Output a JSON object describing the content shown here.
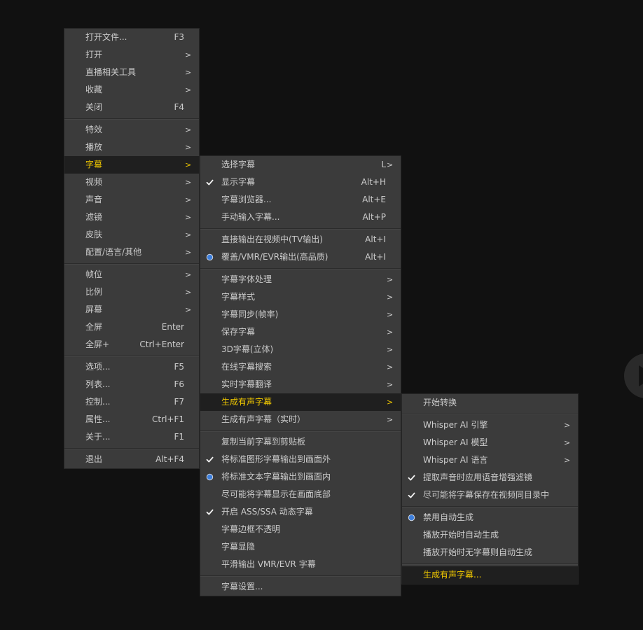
{
  "colors": {
    "page_background": "#111111",
    "menu_background": "#3b3b3b",
    "menu_text": "#cccccc",
    "highlight_background": "#1f1f1f",
    "highlight_text": "#f0c800",
    "radio_fill": "#3d7fdc"
  },
  "menus": {
    "main": {
      "sections": [
        [
          {
            "label": "打开文件...",
            "shortcut": "F3"
          },
          {
            "label": "打开",
            "arrow": ">"
          },
          {
            "label": "直播相关工具",
            "arrow": ">"
          },
          {
            "label": "收藏",
            "arrow": ">"
          },
          {
            "label": "关闭",
            "shortcut": "F4"
          }
        ],
        [
          {
            "label": "特效",
            "arrow": ">"
          },
          {
            "label": "播放",
            "arrow": ">"
          },
          {
            "label": "字幕",
            "arrow": ">",
            "highlighted": true
          },
          {
            "label": "视频",
            "arrow": ">"
          },
          {
            "label": "声音",
            "arrow": ">"
          },
          {
            "label": "滤镜",
            "arrow": ">"
          },
          {
            "label": "皮肤",
            "arrow": ">"
          },
          {
            "label": "配置/语言/其他",
            "arrow": ">"
          }
        ],
        [
          {
            "label": "帧位",
            "arrow": ">"
          },
          {
            "label": "比例",
            "arrow": ">"
          },
          {
            "label": "屏幕",
            "arrow": ">"
          },
          {
            "label": "全屏",
            "shortcut": "Enter"
          },
          {
            "label": "全屏+",
            "shortcut": "Ctrl+Enter"
          }
        ],
        [
          {
            "label": "选项...",
            "shortcut": "F5"
          },
          {
            "label": "列表...",
            "shortcut": "F6"
          },
          {
            "label": "控制...",
            "shortcut": "F7"
          },
          {
            "label": "属性...",
            "shortcut": "Ctrl+F1"
          },
          {
            "label": "关于...",
            "shortcut": "F1"
          }
        ],
        [
          {
            "label": "退出",
            "shortcut": "Alt+F4"
          }
        ]
      ]
    },
    "subtitle": {
      "sections": [
        [
          {
            "label": "选择字幕",
            "shortcut": "L",
            "arrow": ">"
          },
          {
            "label": "显示字幕",
            "shortcut": "Alt+H",
            "indicator": "check-icon"
          },
          {
            "label": "字幕浏览器...",
            "shortcut": "Alt+E"
          },
          {
            "label": "手动输入字幕...",
            "shortcut": "Alt+P"
          }
        ],
        [
          {
            "label": "直接输出在视频中(TV输出)",
            "shortcut": "Alt+I"
          },
          {
            "label": "覆盖/VMR/EVR输出(高品质)",
            "shortcut": "Alt+I",
            "indicator": "radio-dot-icon"
          }
        ],
        [
          {
            "label": "字幕字体处理",
            "arrow": ">"
          },
          {
            "label": "字幕样式",
            "arrow": ">"
          },
          {
            "label": "字幕同步(帧率)",
            "arrow": ">"
          },
          {
            "label": "保存字幕",
            "arrow": ">"
          },
          {
            "label": "3D字幕(立体)",
            "arrow": ">"
          },
          {
            "label": "在线字幕搜索",
            "arrow": ">"
          },
          {
            "label": "实时字幕翻译",
            "arrow": ">"
          },
          {
            "label": "生成有声字幕",
            "arrow": ">",
            "highlighted": true
          },
          {
            "label": "生成有声字幕（实时）",
            "arrow": ">"
          }
        ],
        [
          {
            "label": "复制当前字幕到剪贴板"
          },
          {
            "label": "将标准图形字幕输出到画面外",
            "indicator": "check-icon"
          },
          {
            "label": "将标准文本字幕输出到画面内",
            "indicator": "radio-dot-icon"
          },
          {
            "label": "尽可能将字幕显示在画面底部"
          },
          {
            "label": "开启 ASS/SSA 动态字幕",
            "indicator": "check-icon"
          },
          {
            "label": "字幕边框不透明"
          },
          {
            "label": "字幕显隐"
          },
          {
            "label": "平滑输出 VMR/EVR 字幕"
          }
        ],
        [
          {
            "label": "字幕设置..."
          }
        ]
      ]
    },
    "generate": {
      "sections": [
        [
          {
            "label": "开始转换"
          }
        ],
        [
          {
            "label": "Whisper AI 引擎",
            "arrow": ">"
          },
          {
            "label": "Whisper AI 模型",
            "arrow": ">"
          },
          {
            "label": "Whisper AI 语言",
            "arrow": ">"
          },
          {
            "label": "提取声音时应用语音增强滤镜",
            "indicator": "check-icon"
          },
          {
            "label": "尽可能将字幕保存在视频同目录中",
            "indicator": "check-icon"
          }
        ],
        [
          {
            "label": "禁用自动生成",
            "indicator": "radio-dot-icon"
          },
          {
            "label": "播放开始时自动生成"
          },
          {
            "label": "播放开始时无字幕则自动生成"
          }
        ],
        [
          {
            "label": "生成有声字幕...",
            "highlighted": true
          }
        ]
      ]
    }
  }
}
